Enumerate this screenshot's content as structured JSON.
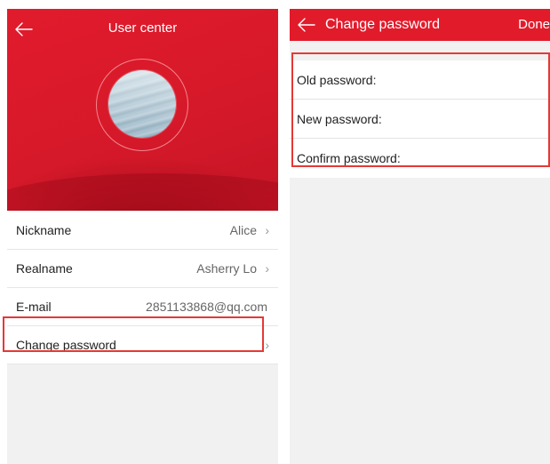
{
  "left_screen": {
    "title": "User center",
    "rows": [
      {
        "label": "Nickname",
        "value": "Alice"
      },
      {
        "label": "Realname",
        "value": "Asherry Lo"
      },
      {
        "label": "E-mail",
        "value": "2851133868@qq.com"
      },
      {
        "label": "Change password",
        "value": ""
      }
    ]
  },
  "right_screen": {
    "title": "Change password",
    "done_label": "Done",
    "fields": [
      {
        "label": "Old password:"
      },
      {
        "label": "New password:"
      },
      {
        "label": "Confirm password:"
      }
    ]
  },
  "colors": {
    "brand_red": "#e21b2b",
    "highlight_red": "#e53935",
    "background": "#f1f1f1"
  },
  "icons": [
    "back-arrow-icon",
    "chevron-right-icon"
  ]
}
